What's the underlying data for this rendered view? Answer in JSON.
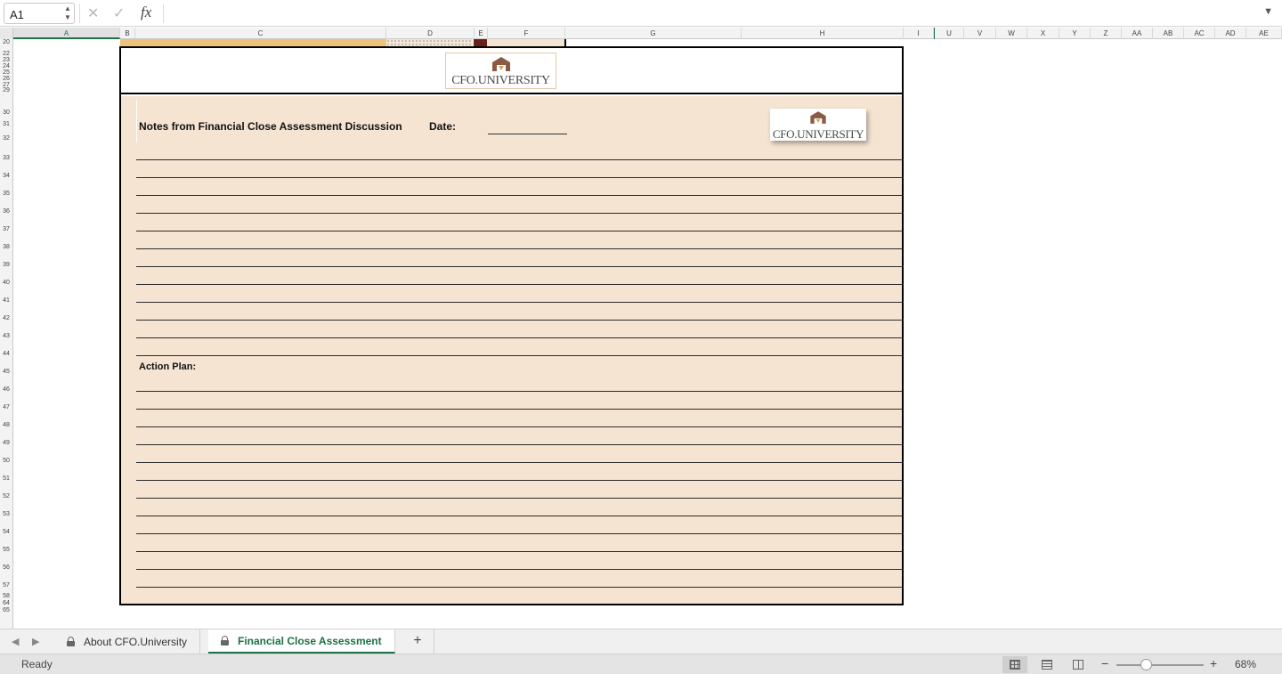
{
  "formula_bar": {
    "name_box": "A1",
    "cancel_icon": "✕",
    "enter_icon": "✓",
    "fx_label": "fx",
    "formula": ""
  },
  "columns": [
    "A",
    "B",
    "C",
    "D",
    "E",
    "F",
    "G",
    "H",
    "I",
    "U",
    "V",
    "W",
    "X",
    "Y",
    "Z",
    "AA",
    "AB",
    "AC",
    "AD",
    "AE"
  ],
  "rows": [
    "20",
    "22",
    "23",
    "24",
    "25",
    "26",
    "27",
    "29",
    "30",
    "31",
    "32",
    "33",
    "34",
    "35",
    "36",
    "37",
    "38",
    "39",
    "40",
    "41",
    "42",
    "43",
    "44",
    "45",
    "46",
    "47",
    "48",
    "49",
    "50",
    "51",
    "52",
    "53",
    "54",
    "55",
    "56",
    "57",
    "58",
    "64",
    "65"
  ],
  "sheet": {
    "logo_text": "CFO.UNIVERSITY",
    "notes_title": "Notes from Financial Close Assessment  Discussion",
    "date_label": "Date:",
    "action_plan_label": "Action Plan:"
  },
  "tabs": {
    "items": [
      {
        "label": "About CFO.University",
        "locked": true,
        "active": false
      },
      {
        "label": "Financial Close Assessment",
        "locked": true,
        "active": true
      }
    ],
    "add_label": "+"
  },
  "status": {
    "text": "Ready",
    "zoom": "68%",
    "zoom_minus": "−",
    "zoom_plus": "+"
  },
  "colors": {
    "accent": "#1e7145",
    "panel": "#f5e4d1",
    "band_orange": "#ecc27d",
    "band_dark": "#6b1f1a",
    "logo_brown": "#8a5a44",
    "logo_gold": "#d6a65a"
  }
}
